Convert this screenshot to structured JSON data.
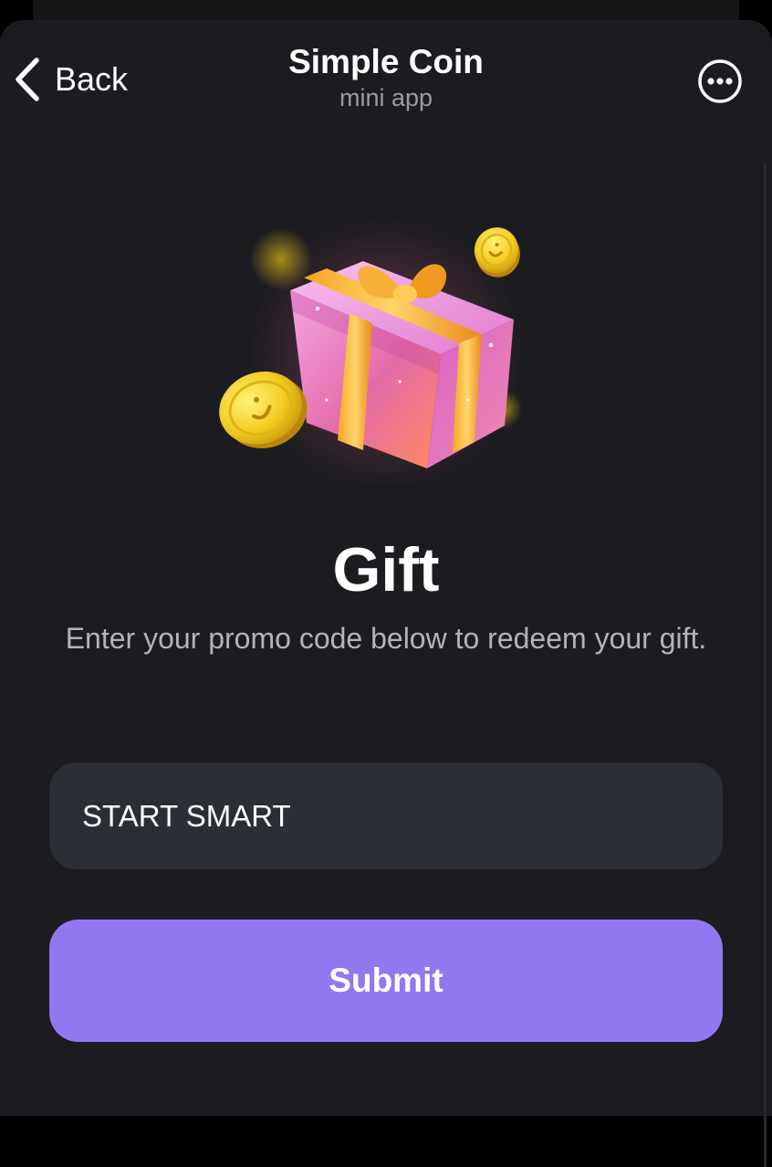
{
  "header": {
    "back_label": "Back",
    "title": "Simple Coin",
    "subtitle": "mini app",
    "more_icon": "more-horizontal-circle-icon"
  },
  "content": {
    "illustration": "gift-box-with-coins",
    "title": "Gift",
    "description": "Enter your promo code below to redeem your gift."
  },
  "form": {
    "promo_code_value": "START SMART",
    "submit_label": "Submit"
  },
  "colors": {
    "background": "#1c1c20",
    "input_background": "#2c2e36",
    "accent": "#9178f0",
    "text_primary": "#ffffff",
    "text_secondary": "#b3b3b9"
  }
}
